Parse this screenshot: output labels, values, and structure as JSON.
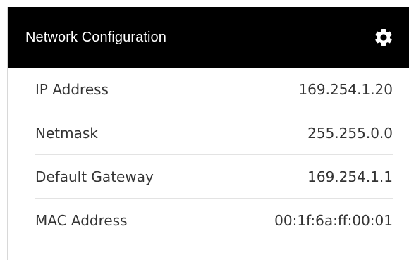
{
  "panel": {
    "title": "Network Configuration",
    "settings_icon": "gear-icon"
  },
  "rows": [
    {
      "label": "IP Address",
      "value": "169.254.1.20"
    },
    {
      "label": "Netmask",
      "value": "255.255.0.0"
    },
    {
      "label": "Default Gateway",
      "value": "169.254.1.1"
    },
    {
      "label": "MAC Address",
      "value": "00:1f:6a:ff:00:01"
    }
  ],
  "colors": {
    "header_bg": "#000000",
    "header_text": "#ffffff",
    "divider": "#e3e3e3",
    "body_text": "#333333"
  }
}
